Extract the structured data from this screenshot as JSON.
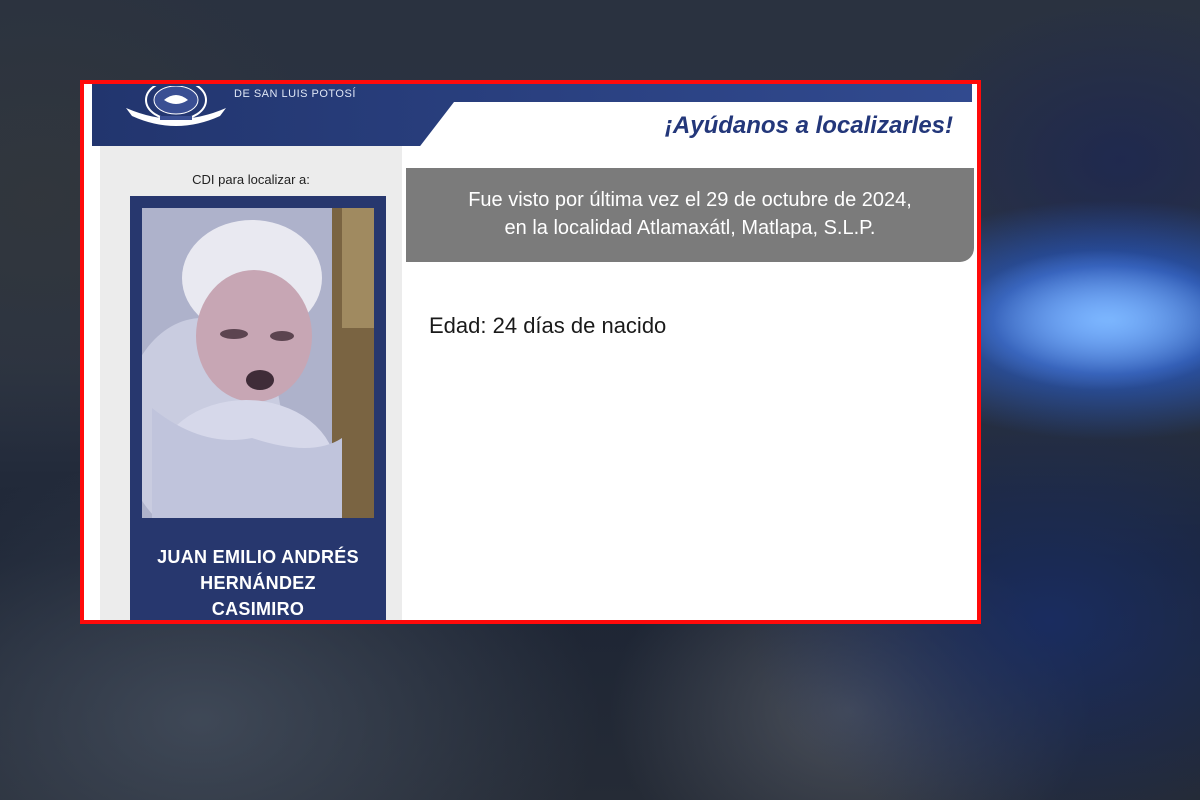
{
  "poster": {
    "agency_text": "DE SAN LUIS POTOSÍ",
    "slogan": "¡Ayúdanos a localizarles!",
    "cdi_label": "CDI para localizar a:",
    "name_lines": [
      "JUAN EMILIO ANDRÉS",
      "HERNÁNDEZ",
      "CASIMIRO"
    ],
    "last_seen_lines": [
      "Fue visto por última vez el 29 de octubre de 2024,",
      "en la localidad Atlamaxátl, Matlapa, S.L.P."
    ],
    "age": "Edad: 24 días de nacido",
    "colors": {
      "frame_border": "#ff0a0a",
      "header_blue": "#22356e",
      "slogan_blue": "#23377a",
      "grey_box": "#7b7b7b",
      "left_column": "#ececec"
    }
  }
}
